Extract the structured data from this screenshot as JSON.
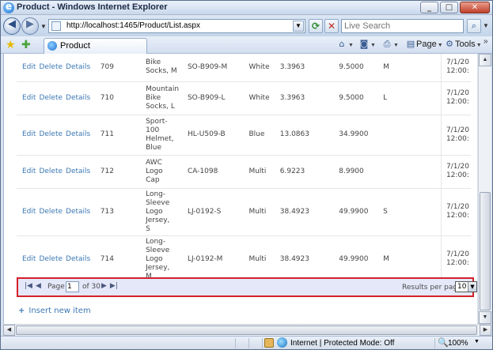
{
  "window": {
    "title": "Product - Windows Internet Explorer",
    "min": "_",
    "max": "□",
    "close": "✕"
  },
  "address": {
    "url": "http://localhost:1465/Product/List.aspx",
    "search_placeholder": "Live Search"
  },
  "tab": {
    "label": "Product"
  },
  "commandbar": {
    "home_icon": "home-icon",
    "feeds_icon": "feeds-icon",
    "print_icon": "print-icon",
    "page_label": "Page",
    "tools_label": "Tools"
  },
  "grid": {
    "action_labels": [
      "Edit",
      "Delete",
      "Details"
    ],
    "rows": [
      {
        "id": "709",
        "name": [
          "Bike",
          "Socks, M"
        ],
        "number": "SO-B909-M",
        "color": "White",
        "cost": "3.3963",
        "price": "9.5000",
        "size": "M",
        "date": [
          "7/1/20",
          "12:00:"
        ]
      },
      {
        "id": "710",
        "name": [
          "Mountain",
          "Bike",
          "Socks, L"
        ],
        "number": "SO-B909-L",
        "color": "White",
        "cost": "3.3963",
        "price": "9.5000",
        "size": "L",
        "date": [
          "7/1/20",
          "12:00:"
        ]
      },
      {
        "id": "711",
        "name": [
          "Sport-",
          "100",
          "Helmet,",
          "Blue"
        ],
        "number": "HL-U509-B",
        "color": "Blue",
        "cost": "13.0863",
        "price": "34.9900",
        "size": "",
        "date": [
          "7/1/20",
          "12:00:"
        ]
      },
      {
        "id": "712",
        "name": [
          "AWC",
          "Logo",
          "Cap"
        ],
        "number": "CA-1098",
        "color": "Multi",
        "cost": "6.9223",
        "price": "8.9900",
        "size": "",
        "date": [
          "7/1/20",
          "12:00:"
        ]
      },
      {
        "id": "713",
        "name": [
          "Long-",
          "Sleeve",
          "Logo",
          "Jersey,",
          "S"
        ],
        "number": "LJ-0192-S",
        "color": "Multi",
        "cost": "38.4923",
        "price": "49.9900",
        "size": "S",
        "date": [
          "7/1/20",
          "12:00:"
        ]
      },
      {
        "id": "714",
        "name": [
          "Long-",
          "Sleeve",
          "Logo",
          "Jersey,",
          "M"
        ],
        "number": "LJ-0192-M",
        "color": "Multi",
        "cost": "38.4923",
        "price": "49.9900",
        "size": "M",
        "date": [
          "7/1/20",
          "12:00:"
        ]
      }
    ]
  },
  "pager": {
    "page_label": "Page",
    "current_page": "1",
    "of_text": "of 30",
    "results_label": "Results per page:",
    "results_value": "10",
    "accent_color": "#d4202a",
    "background_color": "#e5e8f9"
  },
  "insert_link": "Insert new item",
  "status": {
    "zone": "Internet | Protected Mode: Off",
    "zoom": "100%"
  }
}
